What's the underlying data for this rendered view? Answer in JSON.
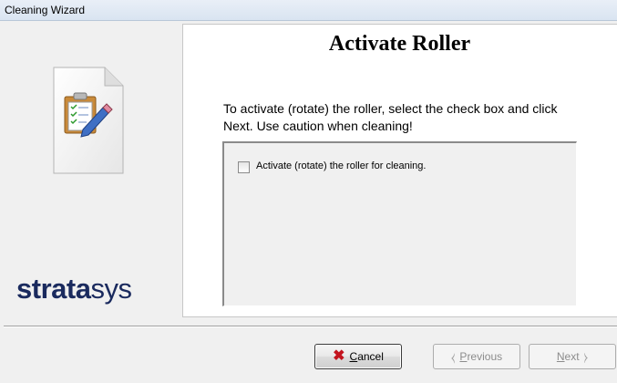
{
  "window": {
    "title": "Cleaning Wizard"
  },
  "brand": {
    "logo_bold": "strata",
    "logo_light": "sys",
    "icon": "clipboard-document-icon"
  },
  "page": {
    "title": "Activate Roller",
    "instructions": "To activate (rotate) the roller, select the check box and click Next. Use caution when cleaning!"
  },
  "option": {
    "checkbox_label": "Activate (rotate) the roller for cleaning.",
    "checked": false
  },
  "buttons": {
    "cancel": {
      "mnemonic": "C",
      "rest": "ancel",
      "icon": "x-icon",
      "enabled": true
    },
    "previous": {
      "mnemonic": "P",
      "rest": "revious",
      "icon": "back-arrow-icon",
      "enabled": false
    },
    "next": {
      "mnemonic": "N",
      "rest": "ext",
      "icon": "forward-arrow-icon",
      "enabled": false
    }
  },
  "colors": {
    "cancel_x": "#c3141e",
    "logo": "#1a2a5e",
    "disabled_text": "#8c8c8c"
  }
}
